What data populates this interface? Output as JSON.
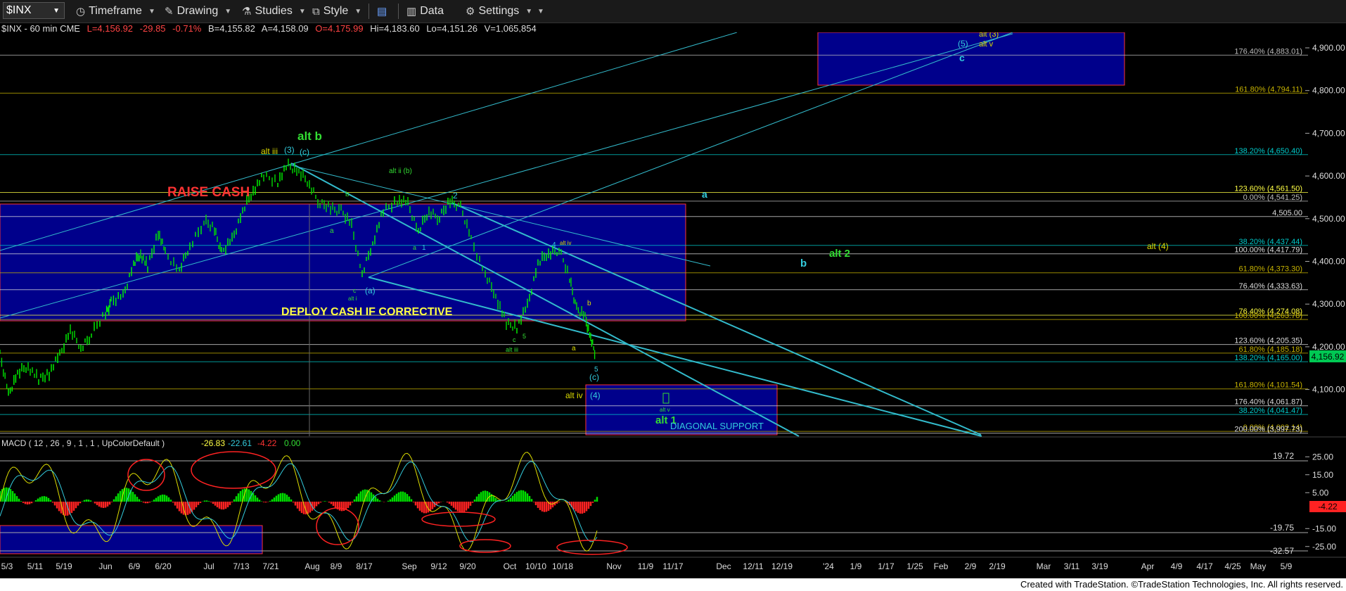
{
  "toolbar": {
    "symbol": "$INX",
    "timeframe": "Timeframe",
    "drawing": "Drawing",
    "studies": "Studies",
    "style": "Style",
    "data": "Data",
    "settings": "Settings"
  },
  "quote": {
    "name": "$INX - 60 min  CME",
    "last": "L=4,156.92",
    "chg": "-29.85",
    "pct": "-0.71%",
    "bid": "B=4,155.82",
    "ask": "A=4,158.09",
    "open": "O=4,175.99",
    "high": "Hi=4,183.60",
    "low": "Lo=4,151.26",
    "vol": "V=1,065,854"
  },
  "price_axis": [
    "4,900.00",
    "4,800.00",
    "4,700.00",
    "4,600.00",
    "4,500.00",
    "4,400.00",
    "4,300.00",
    "4,200.00",
    "4,100.00"
  ],
  "price_tag": "4,156.92",
  "fib_labels": [
    {
      "t": "176.40% (4,883.01)",
      "c": "#bbbbbb",
      "p": 4883
    },
    {
      "t": "161.80% (4,794.11)",
      "c": "#c8b400",
      "p": 4794
    },
    {
      "t": "138.20% (4,650.40)",
      "c": "#00cccc",
      "p": 4650
    },
    {
      "t": "123.60% (4,561.50)",
      "c": "#ffff44",
      "p": 4561.5
    },
    {
      "t": "0.00% (4,541.25)",
      "c": "#bbbbbb",
      "p": 4541
    },
    {
      "t": "4,505.00",
      "c": "#dddddd",
      "p": 4505
    },
    {
      "t": "38.20% (4,437.44)",
      "c": "#00cccc",
      "p": 4437.4
    },
    {
      "t": "100.00% (4,417.79)",
      "c": "#dddddd",
      "p": 4417.8
    },
    {
      "t": "61.80% (4,373.30)",
      "c": "#c8b400",
      "p": 4373.3
    },
    {
      "t": "76.40% (4,333.63)",
      "c": "#dddddd",
      "p": 4333.6
    },
    {
      "t": "76.40% (4,274.08)",
      "c": "#ffff44",
      "p": 4274
    },
    {
      "t": "100.00% (4,263.78)",
      "c": "#c8b400",
      "p": 4263.8
    },
    {
      "t": "123.60% (4,205.35)",
      "c": "#dddddd",
      "p": 4205.4
    },
    {
      "t": "61.80% (4,185.18)",
      "c": "#c8b400",
      "p": 4185.2
    },
    {
      "t": "138.20% (4,165.00)",
      "c": "#00cccc",
      "p": 4165
    },
    {
      "t": "161.80% (4,101.54)",
      "c": "#c8b400",
      "p": 4101.5
    },
    {
      "t": "176.40% (4,061.87)",
      "c": "#dddddd",
      "p": 4061.9
    },
    {
      "t": "38.20% (4,041.47)",
      "c": "#00cccc",
      "p": 4041.5
    },
    {
      "t": "0.00% (4,002.14)",
      "c": "#c8b400",
      "p": 4002
    },
    {
      "t": "200.00% (3,997.73)",
      "c": "#dddddd",
      "p": 3997.7
    }
  ],
  "annotations": {
    "alt_b": "alt b",
    "alt_iii": "alt iii",
    "w3": "(3)",
    "wc": "(c)",
    "raise_cash": "RAISE CASH",
    "deploy_cash": "DEPLOY CASH IF CORRECTIVE",
    "alt_ii_b": "alt ii (b)",
    "a_top": "a",
    "b_mid": "b",
    "alt_2": "alt 2",
    "alt_4": "alt (4)",
    "alt_1": "alt 1",
    "alt_iv": "alt iv",
    "w4": "(4)",
    "diag_support": "DIAGONAL SUPPORT",
    "w5": "(5)",
    "c_top": "c",
    "alt_3": "alt (3)",
    "alt_v": "alt v",
    "wa": "(a)",
    "wc2": "(c)",
    "n5": "5",
    "n2": "2",
    "n1": "1",
    "n4": "4",
    "alt_iv2": "alt iv",
    "alt_iii2": "alt iii",
    "alt_i": "alt i",
    "small_b": "b",
    "small_a": "a",
    "small_c": "c",
    "small_5": "5",
    "small_b2": "b",
    "small_a2": "a",
    "small_a3": "a",
    "alt_v2": "alt v",
    "small_c2": "c"
  },
  "macd": {
    "title": "MACD ( 12 , 26 , 9 , 1 , 1 , UpColorDefault )",
    "v1": "-26.83",
    "v2": "-22.61",
    "v3": "-4.22",
    "v4": "0.00",
    "axis": [
      "25.00",
      "15.00",
      "5.00",
      "-15.00",
      "-25.00"
    ],
    "line_labels": [
      "19.72",
      "-19.75",
      "-32.57"
    ],
    "tag": "-4.22"
  },
  "dates": [
    "5/3",
    "5/11",
    "5/19",
    "Jun",
    "6/9",
    "6/20",
    "Jul",
    "7/13",
    "7/21",
    "Aug",
    "8/9",
    "8/17",
    "Sep",
    "9/12",
    "9/20",
    "Oct",
    "10/10",
    "10/18",
    "Nov",
    "11/9",
    "11/17",
    "Dec",
    "12/11",
    "12/19",
    "'24",
    "1/9",
    "1/17",
    "1/25",
    "Feb",
    "2/9",
    "2/19",
    "Mar",
    "3/11",
    "3/19",
    "Apr",
    "4/9",
    "4/17",
    "4/25",
    "May",
    "5/9"
  ],
  "footer": "Created with TradeStation. ©TradeStation Technologies, Inc. All rights reserved.",
  "colors": {
    "up": "#00ff00",
    "down": "#ff3333",
    "cyan": "#33ccdd",
    "box": "#00008b",
    "green_label": "#33dd33",
    "yellow_label": "#dddd00",
    "red_label": "#ff3333"
  }
}
